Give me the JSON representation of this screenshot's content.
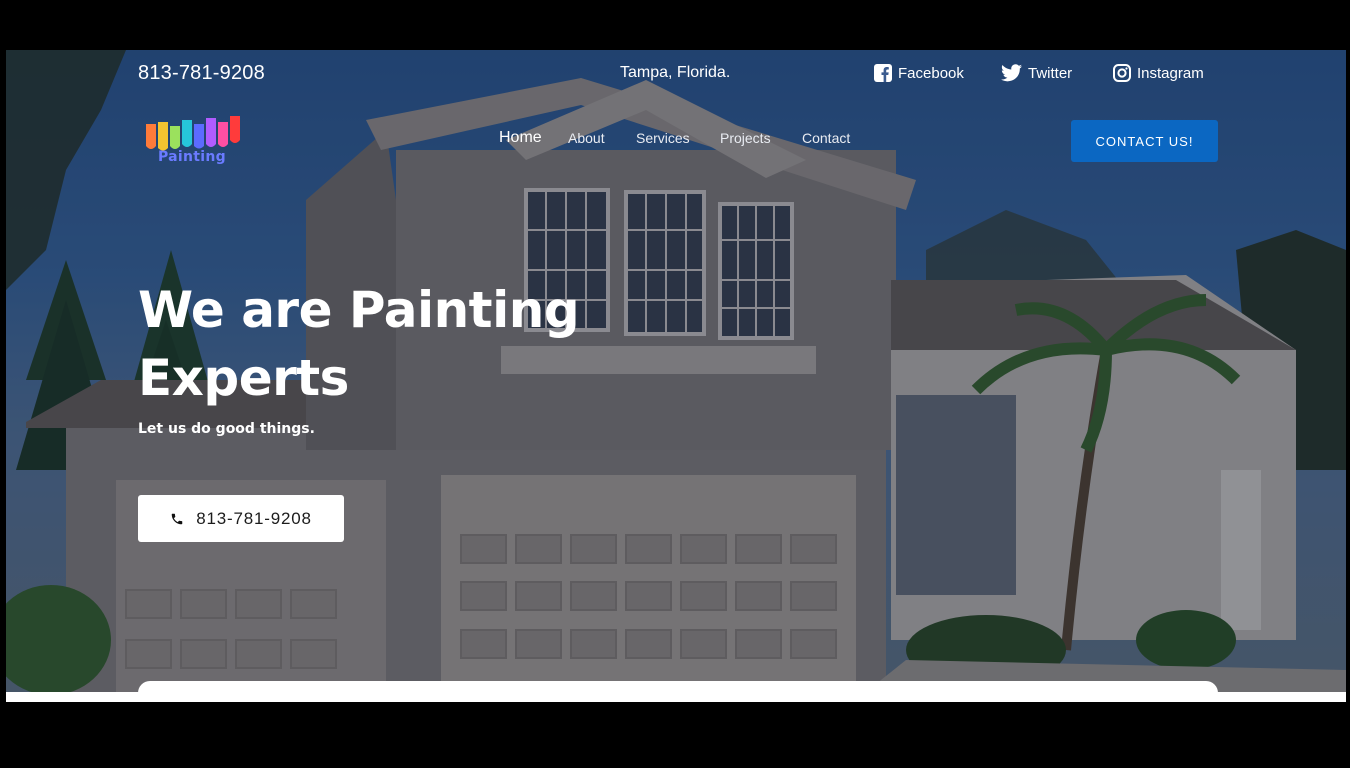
{
  "topbar": {
    "phone": "813-781-9208",
    "location": "Tampa, Florida.",
    "social": [
      {
        "label": "Facebook",
        "icon": "facebook-icon"
      },
      {
        "label": "Twitter",
        "icon": "twitter-icon"
      },
      {
        "label": "Instagram",
        "icon": "instagram-icon"
      }
    ]
  },
  "header": {
    "logo_text": "Painting",
    "nav": [
      {
        "label": "Home",
        "active": true
      },
      {
        "label": "About",
        "active": false
      },
      {
        "label": "Services",
        "active": false
      },
      {
        "label": "Projects",
        "active": false
      },
      {
        "label": "Contact",
        "active": false
      }
    ],
    "cta_label": "CONTACT US!"
  },
  "hero": {
    "headline_line1": "We are Painting",
    "headline_line2": "Experts",
    "subline": "Let us do good things.",
    "call_button_label": "813-781-9208",
    "call_icon": "phone-icon"
  },
  "colors": {
    "accent": "#0b67c2",
    "background": "#000000"
  }
}
